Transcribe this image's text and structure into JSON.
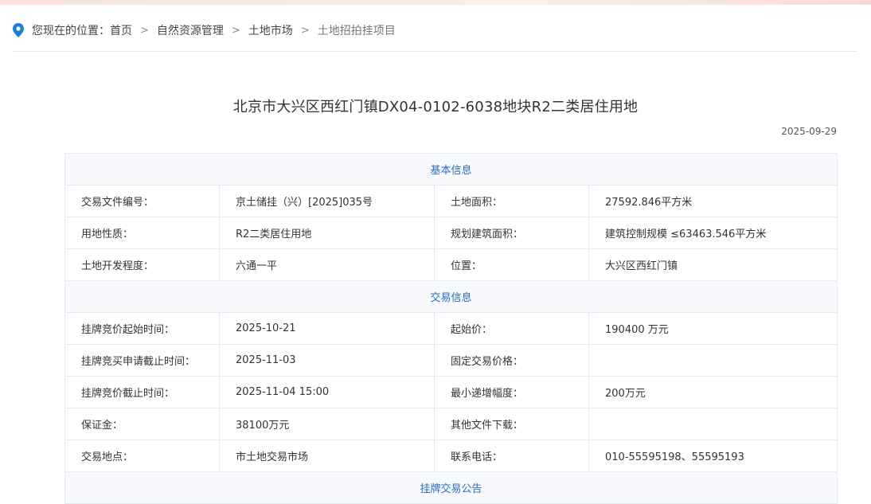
{
  "breadcrumb": {
    "prefix": "您现在的位置：",
    "items": [
      "首页",
      "自然资源管理",
      "土地市场",
      "土地招拍挂项目"
    ],
    "separator": ">"
  },
  "article": {
    "title": "北京市大兴区西红门镇DX04-0102-6038地块R2二类居住用地",
    "date": "2025-09-29"
  },
  "sections": {
    "basic": {
      "title": "基本信息",
      "rows": [
        {
          "l1": "交易文件编号：",
          "v1": "京土储挂（兴）[2025]035号",
          "l2": "土地面积：",
          "v2": "27592.846平方米"
        },
        {
          "l1": "用地性质：",
          "v1": "R2二类居住用地",
          "l2": "规划建筑面积：",
          "v2": "建筑控制规模 ≤63463.546平方米"
        },
        {
          "l1": "土地开发程度：",
          "v1": "六通一平",
          "l2": "位置：",
          "v2": "大兴区西红门镇"
        }
      ]
    },
    "trade": {
      "title": "交易信息",
      "rows": [
        {
          "l1": "挂牌竞价起始时间：",
          "v1": "2025-10-21",
          "l2": "起始价：",
          "v2": "190400 万元"
        },
        {
          "l1": "挂牌竞买申请截止时间：",
          "v1": "2025-11-03",
          "l2": "固定交易价格：",
          "v2": ""
        },
        {
          "l1": "挂牌竞价截止时间：",
          "v1": "2025-11-04 15:00",
          "l2": "最小递增幅度：",
          "v2": "200万元"
        },
        {
          "l1": "保证金：",
          "v1": "38100万元",
          "l2": "其他文件下载：",
          "v2": ""
        },
        {
          "l1": "交易地点：",
          "v1": "市土地交易市场",
          "l2": "联系电话：",
          "v2": "010-55595198、55595193"
        }
      ]
    },
    "notice": {
      "title": "挂牌交易公告"
    }
  },
  "colors": {
    "accent": "#2a6ebd",
    "pin": "#1f7fd6",
    "section_bg": "#f7f9fc",
    "border": "#e6ebf2"
  }
}
